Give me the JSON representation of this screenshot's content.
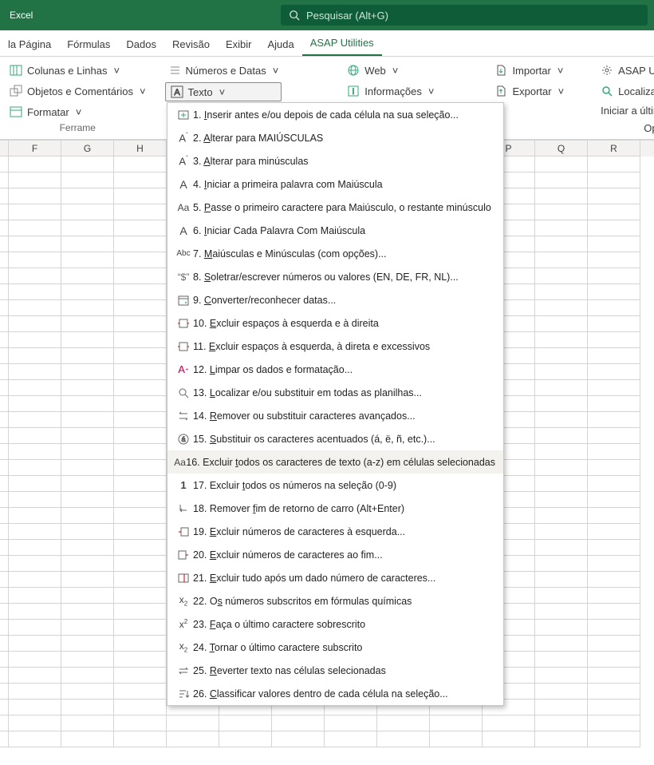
{
  "title": "Excel",
  "search": {
    "placeholder": "Pesquisar (Alt+G)"
  },
  "tabs": [
    "la Página",
    "Fórmulas",
    "Dados",
    "Revisão",
    "Exibir",
    "Ajuda",
    "ASAP Utilities"
  ],
  "activeTab": 6,
  "ribbon": {
    "g1": {
      "a": "Colunas e Linhas",
      "b": "Objetos e Comentários",
      "c": "Formatar",
      "label": "Ferrame"
    },
    "g2": {
      "a": "Números e Datas",
      "b": "Texto"
    },
    "g3": {
      "a": "Web",
      "b": "Informações"
    },
    "g4": {
      "a": "Importar",
      "b": "Exportar"
    },
    "g5": {
      "a": "ASAP Utilities Opções",
      "b": "Localizar e executar um utilitário",
      "c": "Iniciar a última ferramenta novame",
      "d": "Opções e configurações"
    }
  },
  "cols": [
    "",
    "F",
    "G",
    "H",
    "",
    "",
    "",
    "",
    "",
    "",
    "P",
    "Q",
    "R"
  ],
  "menu": [
    {
      "n": "1",
      "t": "Inserir antes e/ou depois de cada célula na sua seleção...",
      "u": "I",
      "ico": "insert"
    },
    {
      "n": "2",
      "t": "Alterar para MAIÚSCULAS",
      "u": "A",
      "ico": "Aup"
    },
    {
      "n": "3",
      "t": "Alterar para minúsculas",
      "u": "A",
      "ico": "Adown"
    },
    {
      "n": "4",
      "t": "Iniciar a primeira palavra com Maiúscula",
      "u": "I",
      "ico": "A"
    },
    {
      "n": "5",
      "t": "Passe o primeiro caractere para Maiúsculo, o restante minúsculo",
      "u": "P",
      "ico": "Aa"
    },
    {
      "n": "6",
      "t": "Iniciar Cada Palavra Com Maiúscula",
      "u": "I",
      "ico": "A"
    },
    {
      "n": "7",
      "t": "Maiúsculas e Minúsculas (com opções)...",
      "u": "M",
      "ico": "Abc"
    },
    {
      "n": "8",
      "t": "Soletrar/escrever números ou valores (EN, DE, FR, NL)...",
      "u": "S",
      "ico": "dollar"
    },
    {
      "n": "9",
      "t": "Converter/reconhecer datas...",
      "u": "C",
      "ico": "date"
    },
    {
      "n": "10",
      "t": "Excluir espaços à esquerda e à direita",
      "u": "E",
      "ico": "trimE"
    },
    {
      "n": "11",
      "t": "Excluir espaços à esquerda, à direta e excessivos",
      "u": "E",
      "ico": "trimE"
    },
    {
      "n": "12",
      "t": "Limpar os dados e formatação...",
      "u": "L",
      "ico": "clean"
    },
    {
      "n": "13",
      "t": "Localizar e/ou substituir em todas as planilhas...",
      "u": "L",
      "ico": "find"
    },
    {
      "n": "14",
      "t": "Remover ou substituir caracteres avançados...",
      "u": "R",
      "ico": "repl"
    },
    {
      "n": "15",
      "t": "Substituir os caracteres acentuados (á, ë, ñ, etc.)...",
      "u": "S",
      "ico": "accent"
    },
    {
      "n": "16",
      "t": "Excluir todos os caracteres de texto (a-z) em células selecionadas",
      "u": "t",
      "ico": "Aa",
      "hover": true
    },
    {
      "n": "17",
      "t": "Excluir todos os números na seleção (0-9)",
      "u": "t",
      "ico": "one"
    },
    {
      "n": "18",
      "t": "Remover fim de retorno de carro (Alt+Enter)",
      "u": "f",
      "ico": "cr"
    },
    {
      "n": "19",
      "t": "Excluir números de caracteres à esquerda...",
      "u": "E",
      "ico": "delL"
    },
    {
      "n": "20",
      "t": "Excluir números de caracteres ao fim...",
      "u": "E",
      "ico": "delR"
    },
    {
      "n": "21",
      "t": "Excluir tudo após um dado número de caracteres...",
      "u": "E",
      "ico": "cut"
    },
    {
      "n": "22",
      "t": "Os números subscritos em fórmulas químicas",
      "u": "s",
      "ico": "sub"
    },
    {
      "n": "23",
      "t": "Faça o último caractere sobrescrito",
      "u": "F",
      "ico": "sup"
    },
    {
      "n": "24",
      "t": "Tornar o último caractere subscrito",
      "u": "T",
      "ico": "sub"
    },
    {
      "n": "25",
      "t": "Reverter texto nas células selecionadas",
      "u": "R",
      "ico": "rev"
    },
    {
      "n": "26",
      "t": "Classificar valores dentro de cada célula na seleção...",
      "u": "C",
      "ico": "sort"
    }
  ]
}
